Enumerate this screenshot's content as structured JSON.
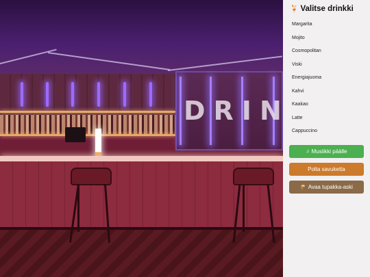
{
  "panel": {
    "title": "Valitse drinkki",
    "title_icon": "cocktail-icon",
    "drinks": [
      "Margarita",
      "Mojito",
      "Cosmopolitan",
      "Viski",
      "Energiajuoma",
      "Kahvi",
      "Kaakao",
      "Latte",
      "Cappuccino"
    ]
  },
  "actions": {
    "music": {
      "label": "Musiikki päälle",
      "icon": "music-note-icon",
      "color": "#4caf50"
    },
    "smoke": {
      "label": "Polta savuketta",
      "color": "#cc7a2c"
    },
    "box": {
      "label": "Avaa tupakka-aski",
      "icon": "box-icon",
      "color": "#8b6a48"
    }
  },
  "scene": {
    "sign_text": "DRINK"
  },
  "colors": {
    "panel_bg": "#f3f0f1",
    "neon": "#9a6cff"
  }
}
